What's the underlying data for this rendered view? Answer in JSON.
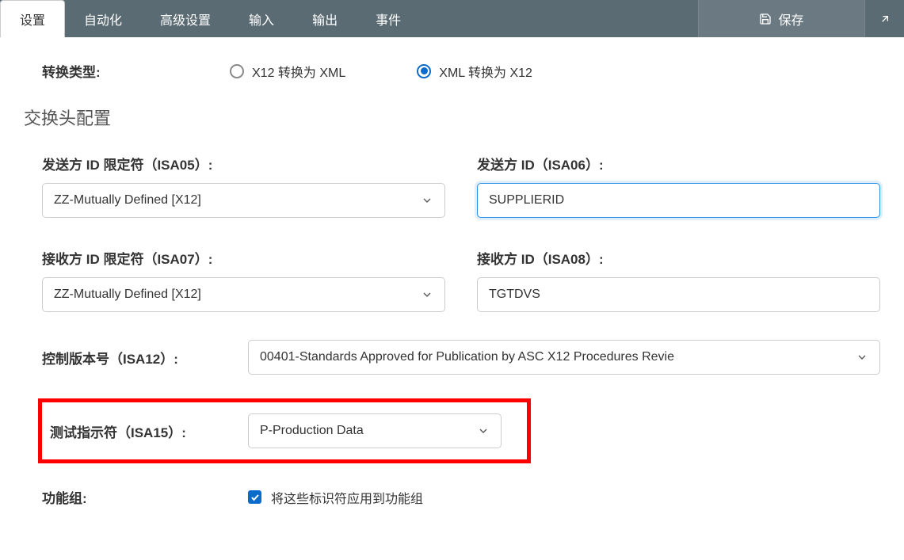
{
  "tabs": {
    "t0": "设置",
    "t1": "自动化",
    "t2": "高级设置",
    "t3": "输入",
    "t4": "输出",
    "t5": "事件"
  },
  "save_label": "保存",
  "conversion": {
    "label": "转换类型:",
    "opt1": "X12 转换为 XML",
    "opt2": "XML 转换为 X12"
  },
  "section_title": "交换头配置",
  "fields": {
    "isa05": {
      "label": "发送方 ID 限定符（ISA05）:",
      "value": "ZZ-Mutually Defined [X12]"
    },
    "isa06": {
      "label": "发送方 ID（ISA06）:",
      "value": "SUPPLIERID"
    },
    "isa07": {
      "label": "接收方 ID 限定符（ISA07）:",
      "value": "ZZ-Mutually Defined [X12]"
    },
    "isa08": {
      "label": "接收方 ID（ISA08）:",
      "value": "TGTDVS"
    },
    "isa12": {
      "label": "控制版本号（ISA12）:",
      "value": "00401-Standards Approved for Publication by ASC X12 Procedures Revie"
    },
    "isa15": {
      "label": "测试指示符（ISA15）:",
      "value": "P-Production Data"
    }
  },
  "func_group": {
    "label": "功能组:",
    "check_label": "将这些标识符应用到功能组"
  }
}
